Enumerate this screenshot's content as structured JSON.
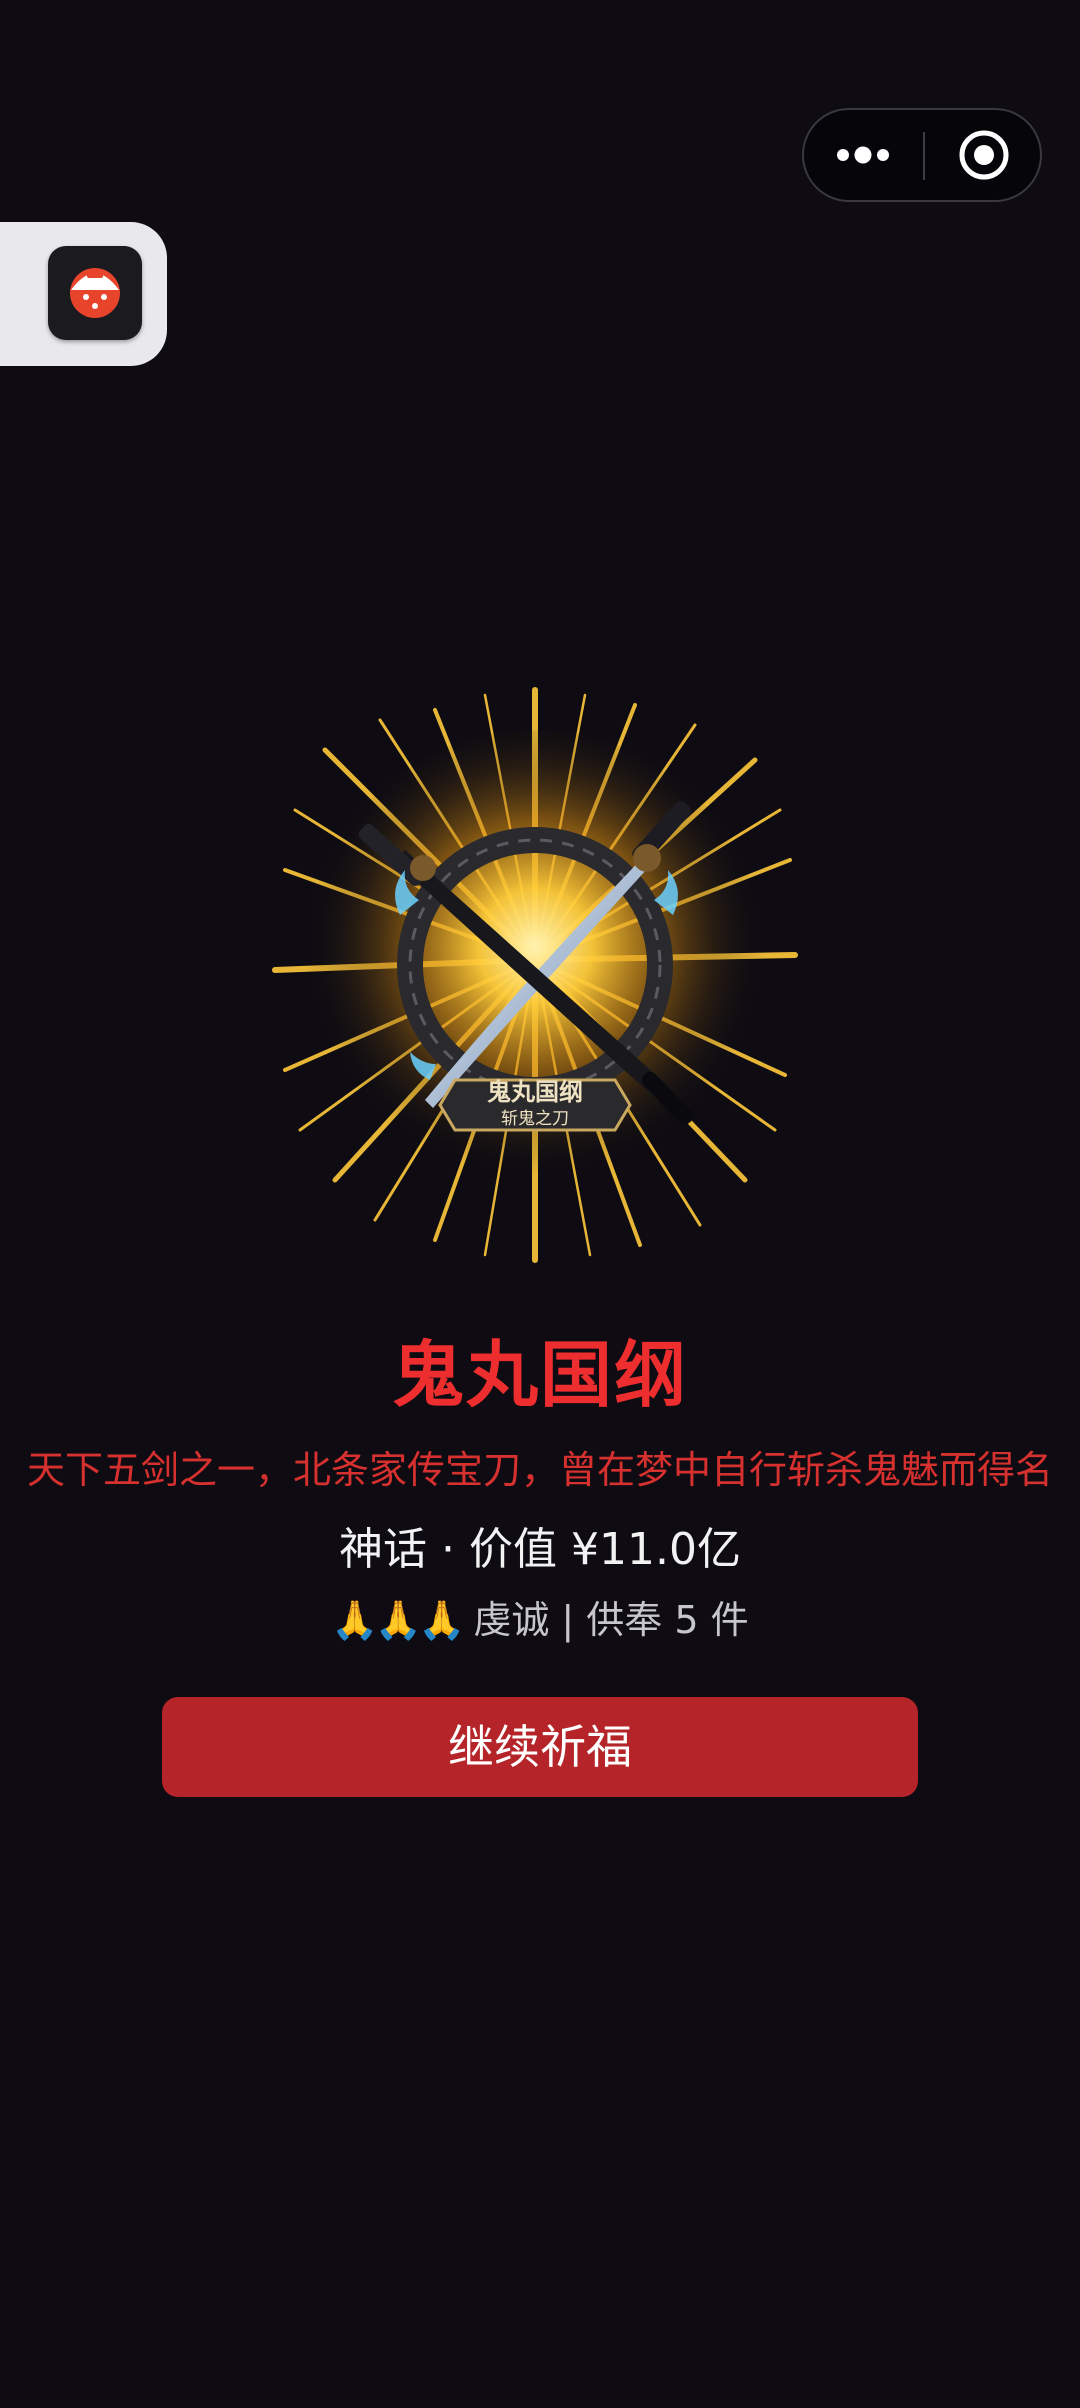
{
  "capsule": {
    "more_icon": "more-dots-icon",
    "close_icon": "target-close-icon"
  },
  "float_tab": {
    "icon": "app-logo-icon"
  },
  "artwork": {
    "plaque_line1": "鬼丸国纲",
    "plaque_line2": "斩鬼之刀"
  },
  "item": {
    "name": "鬼丸国纲",
    "description": "天下五剑之一，北条家传宝刀，曾在梦中自行斩杀鬼魅而得名",
    "value_text": "神话 · 价值 ¥11.0亿",
    "offer_hands": "🙏🙏🙏",
    "offer_text": "虔诚 | 供奉 5 件"
  },
  "actions": {
    "continue_label": "继续祈福"
  },
  "colors": {
    "background": "#0e0c12",
    "title": "#ee2e2e",
    "description": "#d6302f",
    "button": "#b52428"
  }
}
